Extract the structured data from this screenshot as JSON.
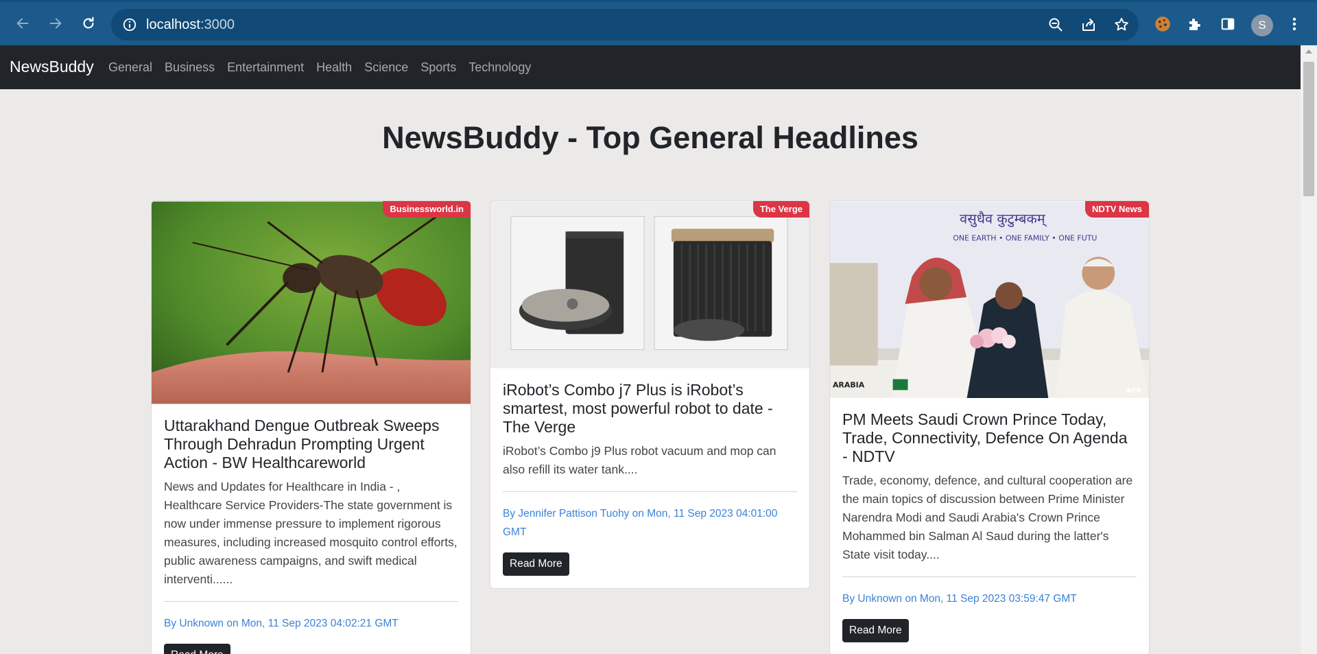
{
  "browser": {
    "url_host": "localhost",
    "url_port": ":3000",
    "profile_initial": "S"
  },
  "navbar": {
    "brand": "NewsBuddy",
    "links": [
      "General",
      "Business",
      "Entertainment",
      "Health",
      "Science",
      "Sports",
      "Technology"
    ]
  },
  "page": {
    "heading": "NewsBuddy - Top General Headlines"
  },
  "cards": [
    {
      "source": "Businessworld.in",
      "title": "Uttarakhand Dengue Outbreak Sweeps Through Dehradun Prompting Urgent Action - BW Healthcareworld",
      "description": "News and Updates for Healthcare in India - , Healthcare Service Providers-The state government is now under immense pressure to implement rigorous measures, including increased mosquito control efforts, public awareness campaigns, and swift medical interventi......",
      "meta": "By Unknown on Mon, 11 Sep 2023 04:02:21 GMT",
      "button": "Read More"
    },
    {
      "source": "The Verge",
      "title": "iRobot’s Combo j7 Plus is iRobot’s smartest, most powerful robot to date - The Verge",
      "description": "iRobot’s Combo j9 Plus robot vacuum and mop can also refill its water tank....",
      "meta": "By Jennifer Pattison Tuohy on Mon, 11 Sep 2023 04:01:00 GMT",
      "button": "Read More"
    },
    {
      "source": "NDTV News",
      "title": "PM Meets Saudi Crown Prince Today, Trade, Connectivity, Defence On Agenda - NDTV",
      "description": "Trade, economy, defence, and cultural cooperation are the main topics of discussion between Prime Minister Narendra Modi and Saudi Arabia's Crown Prince Mohammed bin Salman Al Saud during the latter's State visit today....",
      "meta": "By Unknown on Mon, 11 Sep 2023 03:59:47 GMT",
      "button": "Read More",
      "image_text": {
        "banner": "ONE EARTH • ONE FAMILY • ONE FUTU",
        "credit": "AFP",
        "placard": "ARABIA"
      }
    }
  ]
}
